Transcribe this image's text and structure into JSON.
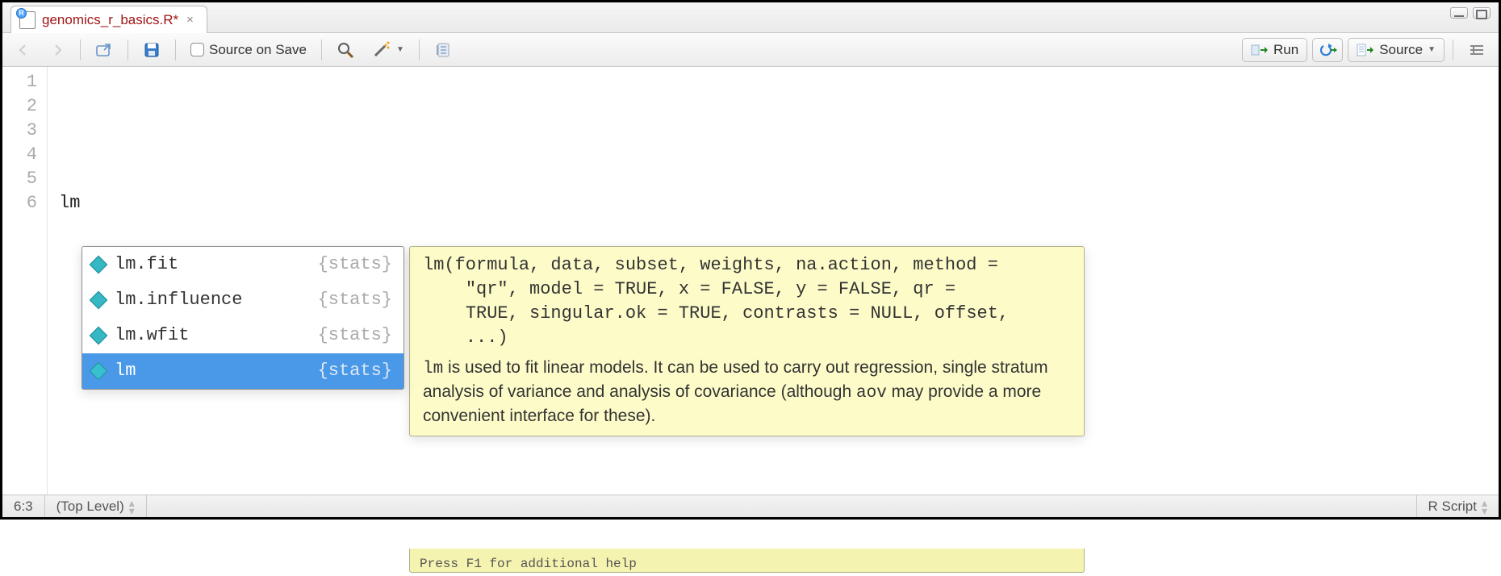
{
  "tab": {
    "filename": "genomics_r_basics.R*",
    "badge": "R"
  },
  "toolbar": {
    "source_on_save_label": "Source on Save",
    "run_label": "Run",
    "source_label": "Source"
  },
  "editor": {
    "gutter_lines": [
      "1",
      "2",
      "3",
      "4",
      "5",
      "6"
    ],
    "code_lines": [
      "",
      "",
      "",
      "",
      "",
      "lm"
    ]
  },
  "autocomplete": {
    "items": [
      {
        "name": "lm.fit",
        "package": "{stats}",
        "selected": false
      },
      {
        "name": "lm.influence",
        "package": "{stats}",
        "selected": false
      },
      {
        "name": "lm.wfit",
        "package": "{stats}",
        "selected": false
      },
      {
        "name": "lm",
        "package": "{stats}",
        "selected": true
      }
    ]
  },
  "help": {
    "signature": "lm(formula, data, subset, weights, na.action, method =\n    \"qr\", model = TRUE, x = FALSE, y = FALSE, qr =\n    TRUE, singular.ok = TRUE, contrasts = NULL, offset,\n    ...)",
    "desc_prefix_mono": "lm",
    "desc_mid1": " is used to fit linear models. It can be used to carry out regression, single stratum analysis of variance and analysis of covariance (although ",
    "desc_mid_mono": "aov",
    "desc_mid2": " may provide a more convenient interface for these).",
    "footer": "Press F1 for additional help"
  },
  "statusbar": {
    "cursor": "6:3",
    "scope": "(Top Level)",
    "filetype": "R Script"
  }
}
